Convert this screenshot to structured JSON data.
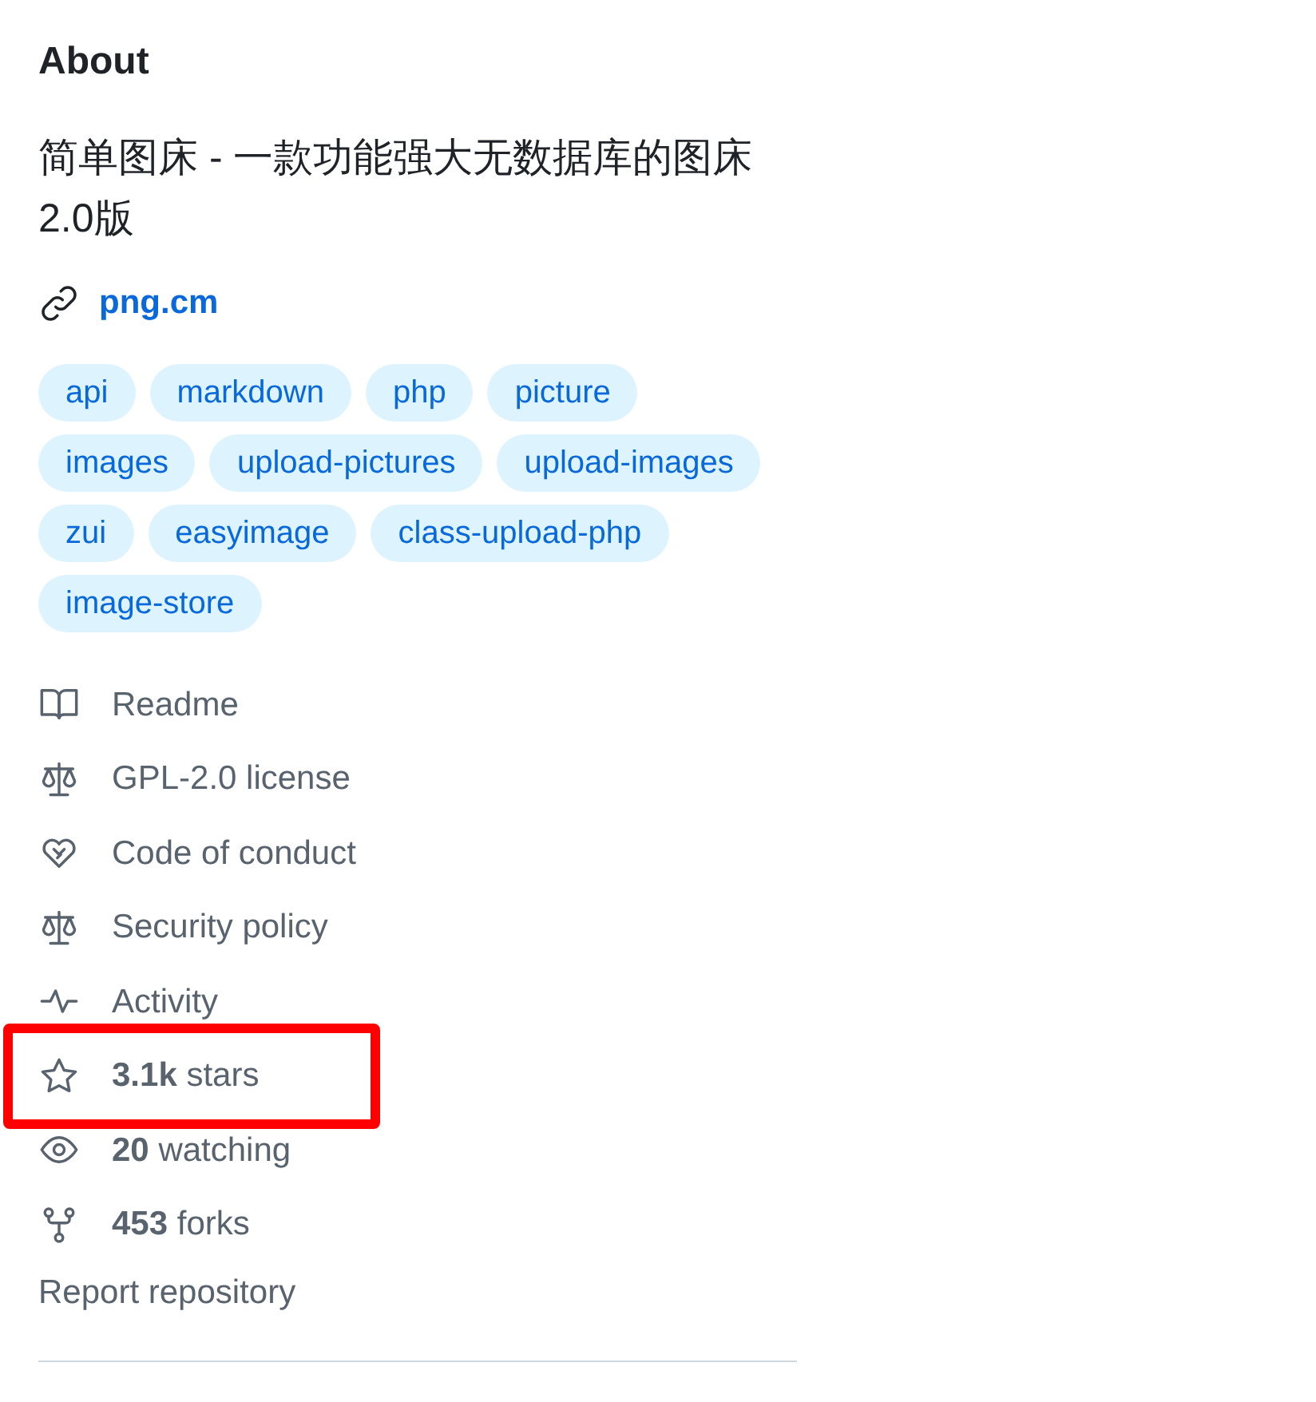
{
  "about": {
    "title": "About",
    "description": "简单图床 - 一款功能强大无数据库的图床 2.0版",
    "link": "png.cm"
  },
  "topics": [
    "api",
    "markdown",
    "php",
    "picture",
    "images",
    "upload-pictures",
    "upload-images",
    "zui",
    "easyimage",
    "class-upload-php",
    "image-store"
  ],
  "items": [
    {
      "kind": "readme",
      "label": "Readme",
      "highlighted": false
    },
    {
      "kind": "license",
      "label": "GPL-2.0 license",
      "highlighted": false
    },
    {
      "kind": "conduct",
      "label": "Code of conduct",
      "highlighted": false
    },
    {
      "kind": "security",
      "label": "Security policy",
      "highlighted": false
    },
    {
      "kind": "activity",
      "label": "Activity",
      "highlighted": false
    },
    {
      "kind": "stars",
      "count": "3.1k",
      "label": "stars",
      "highlighted": true
    },
    {
      "kind": "watchers",
      "count": "20",
      "label": "watching",
      "highlighted": false
    },
    {
      "kind": "forks",
      "count": "453",
      "label": "forks",
      "highlighted": false
    }
  ],
  "report": "Report repository"
}
